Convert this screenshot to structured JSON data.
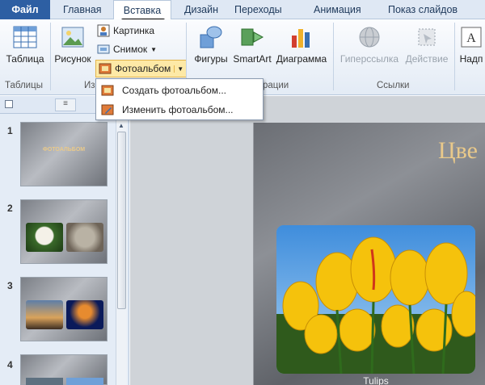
{
  "tabs": {
    "file": "Файл",
    "home": "Главная",
    "insert": "Вставка",
    "design": "Дизайн",
    "transitions": "Переходы",
    "animations": "Анимация",
    "slideshow": "Показ слайдов"
  },
  "ribbon": {
    "table": "Таблица",
    "picture": "Рисунок",
    "clipart": "Картинка",
    "screenshot": "Снимок",
    "photoalbum": "Фотоальбом",
    "shapes": "Фигуры",
    "smartart": "SmartArt",
    "chart": "Диаграмма",
    "hyperlink": "Гиперссылка",
    "action": "Действие",
    "textbox": "Надп",
    "group_tables": "Таблицы",
    "group_images_partial": "Из",
    "group_illustrations_partial": "рации",
    "group_links": "Ссылки"
  },
  "menu": {
    "create": "Создать фотоальбом...",
    "edit": "Изменить фотоальбом..."
  },
  "slides": {
    "numbers": [
      "1",
      "2",
      "3",
      "4"
    ],
    "thumb1_title": "ФОТОАЛЬБОМ"
  },
  "slide": {
    "title_partial": "Цве",
    "caption": "Tulips"
  },
  "colors": {
    "file_tab": "#2d5fa3",
    "ribbon_bg": "#e3ebf5",
    "slide_title": "#e9c98a",
    "photoalbum_highlight": "#fde9a6"
  }
}
